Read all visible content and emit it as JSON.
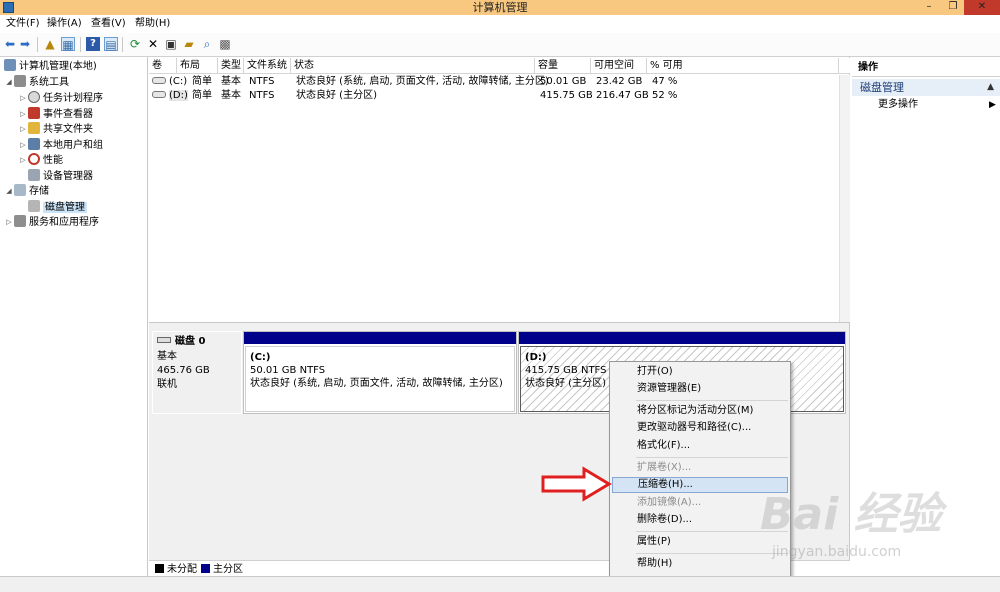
{
  "window": {
    "title": "计算机管理",
    "min": "–",
    "max": "❐",
    "close": "✕"
  },
  "menubar": [
    "文件(F)",
    "操作(A)",
    "查看(V)",
    "帮助(H)"
  ],
  "tree": [
    {
      "label": "计算机管理(本地)",
      "expander": ""
    },
    {
      "label": "系统工具",
      "expander": "◢"
    },
    {
      "label": "任务计划程序",
      "expander": "▷"
    },
    {
      "label": "事件查看器",
      "expander": "▷"
    },
    {
      "label": "共享文件夹",
      "expander": "▷"
    },
    {
      "label": "本地用户和组",
      "expander": "▷"
    },
    {
      "label": "性能",
      "expander": "▷"
    },
    {
      "label": "设备管理器",
      "expander": ""
    },
    {
      "label": "存储",
      "expander": "◢"
    },
    {
      "label": "磁盘管理",
      "expander": ""
    },
    {
      "label": "服务和应用程序",
      "expander": "▷"
    }
  ],
  "volumes": {
    "columns": [
      "卷",
      "布局",
      "类型",
      "文件系统",
      "状态",
      "容量",
      "可用空间",
      "% 可用"
    ],
    "rows": [
      {
        "vol": "(C:)",
        "layout": "简单",
        "type": "基本",
        "fs": "NTFS",
        "status": "状态良好 (系统, 启动, 页面文件, 活动, 故障转储, 主分区)",
        "capacity": "50.01 GB",
        "free": "23.42 GB",
        "pct": "47 %"
      },
      {
        "vol": "(D:)",
        "layout": "简单",
        "type": "基本",
        "fs": "NTFS",
        "status": "状态良好 (主分区)",
        "capacity": "415.75 GB",
        "free": "216.47 GB",
        "pct": "52 %"
      }
    ]
  },
  "disk": {
    "name": "磁盘 0",
    "type": "基本",
    "size": "465.76 GB",
    "state": "联机",
    "partitions": [
      {
        "label": "(C:)",
        "size": "50.01 GB NTFS",
        "status": "状态良好 (系统, 启动, 页面文件, 活动, 故障转储, 主分区)"
      },
      {
        "label": "(D:)",
        "size": "415.75 GB NTFS",
        "status": "状态良好 (主分区)"
      }
    ]
  },
  "legend": [
    {
      "label": "未分配",
      "color": "#000000"
    },
    {
      "label": "主分区",
      "color": "#00008b"
    }
  ],
  "actions": {
    "header": "操作",
    "section": "磁盘管理",
    "more": "更多操作"
  },
  "context_menu": [
    {
      "label": "打开(O)",
      "disabled": false
    },
    {
      "label": "资源管理器(E)",
      "disabled": false
    },
    {
      "label": "将分区标记为活动分区(M)",
      "disabled": false
    },
    {
      "label": "更改驱动器号和路径(C)...",
      "disabled": false
    },
    {
      "label": "格式化(F)...",
      "disabled": false
    },
    {
      "label": "扩展卷(X)...",
      "disabled": true
    },
    {
      "label": "压缩卷(H)...",
      "disabled": false,
      "highlighted": true
    },
    {
      "label": "添加镜像(A)...",
      "disabled": true
    },
    {
      "label": "删除卷(D)...",
      "disabled": false
    },
    {
      "label": "属性(P)",
      "disabled": false
    },
    {
      "label": "帮助(H)",
      "disabled": false
    }
  ],
  "watermark": {
    "brand": "Bai 经验",
    "url": "jingyan.baidu.com"
  },
  "colors": {
    "titlebar": "#f8c880",
    "primary_partition": "#00008b",
    "highlight": "#d5e4f5",
    "arrow": "#e02020"
  }
}
